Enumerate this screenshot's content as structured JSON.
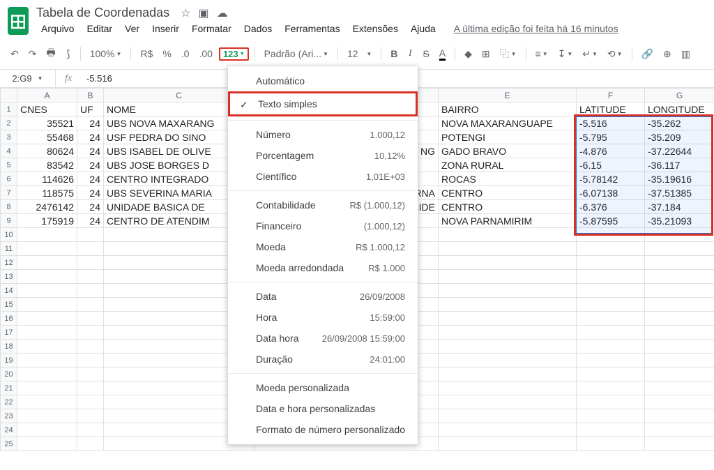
{
  "header": {
    "title": "Tabela de Coordenadas",
    "last_edit": "A última edição foi feita há 16 minutos"
  },
  "menus": [
    "Arquivo",
    "Editar",
    "Ver",
    "Inserir",
    "Formatar",
    "Dados",
    "Ferramentas",
    "Extensões",
    "Ajuda"
  ],
  "toolbar": {
    "zoom": "100%",
    "currency": "R$",
    "percent": "%",
    "dec_dec": ".0",
    "dec_inc": ".00",
    "format_num": "123",
    "font": "Padrão (Ari...",
    "size": "12"
  },
  "formula_bar": {
    "cell": "2:G9",
    "value": "-5.516"
  },
  "columns": [
    "",
    "A",
    "B",
    "C",
    "D",
    "E",
    "F",
    "G"
  ],
  "headers": {
    "a": "CNES",
    "b": "UF",
    "c": "NOME",
    "d": "",
    "e": "BAIRRO",
    "f": "LATITUDE",
    "g": "LONGITUDE"
  },
  "rows": [
    {
      "a": "35521",
      "b": "24",
      "c": "UBS NOVA MAXARANG",
      "e": "NOVA MAXARANGUAPE",
      "f": "-5.516",
      "g": "-35.262"
    },
    {
      "a": "55468",
      "b": "24",
      "c": "USF PEDRA DO SINO",
      "e": "POTENGI",
      "f": "-5.795",
      "g": "-35.209"
    },
    {
      "a": "80624",
      "b": "24",
      "c": "UBS ISABEL DE OLIVE",
      "e2": "NGAGADO BRAVO",
      "f": "-4.876",
      "g": "-37.22644"
    },
    {
      "a": "83542",
      "b": "24",
      "c": "UBS JOSE BORGES D",
      "e": "ZONA RURAL",
      "f": "-6.15",
      "g": "-36.117"
    },
    {
      "a": "114626",
      "b": "24",
      "c": "CENTRO INTEGRADO",
      "e": "ROCAS",
      "f": "-5.78142",
      "g": "-35.19616"
    },
    {
      "a": "118575",
      "b": "24",
      "c": "UBS SEVERINA MARIA",
      "e2": "RNACENTRO",
      "f": "-6.07138",
      "g": "-37.51385"
    },
    {
      "a": "2476142",
      "b": "24",
      "c": "UNIDADE BASICA DE",
      "e2": "AIDECENTRO",
      "f": "-6.376",
      "g": "-37.184"
    },
    {
      "a": "175919",
      "b": "24",
      "c": "CENTRO DE ATENDIM",
      "e": "NOVA PARNAMIRIM",
      "f": "-5.87595",
      "g": "-35.21093"
    }
  ],
  "dropdown": {
    "auto": "Automático",
    "plain": "Texto simples",
    "number": {
      "label": "Número",
      "ex": "1.000,12"
    },
    "percent": {
      "label": "Porcentagem",
      "ex": "10,12%"
    },
    "sci": {
      "label": "Científico",
      "ex": "1,01E+03"
    },
    "acc": {
      "label": "Contabilidade",
      "ex": "R$ (1.000,12)"
    },
    "fin": {
      "label": "Financeiro",
      "ex": "(1.000,12)"
    },
    "cur": {
      "label": "Moeda",
      "ex": "R$ 1.000,12"
    },
    "curR": {
      "label": "Moeda arredondada",
      "ex": "R$ 1.000"
    },
    "date": {
      "label": "Data",
      "ex": "26/09/2008"
    },
    "time": {
      "label": "Hora",
      "ex": "15:59:00"
    },
    "datetime": {
      "label": "Data hora",
      "ex": "26/09/2008 15:59:00"
    },
    "dur": {
      "label": "Duração",
      "ex": "24:01:00"
    },
    "custCur": "Moeda personalizada",
    "custDate": "Data e hora personalizadas",
    "custNum": "Formato de número personalizado"
  }
}
